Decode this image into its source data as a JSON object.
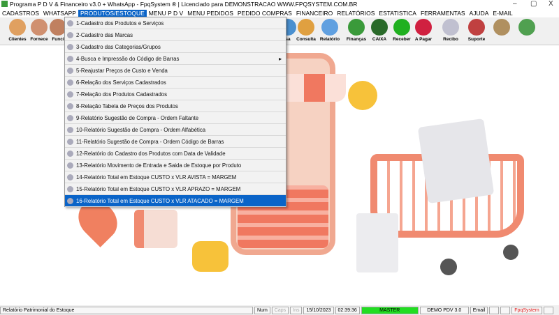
{
  "window": {
    "title": "Programa P D V & Financeiro v3.0 + WhatsApp - FpqSystem ® | Licenciado para  DEMONSTRACAO WWW.FPQSYSTEM.COM.BR",
    "minimize": "–",
    "maximize": "▢",
    "close": "X"
  },
  "menubar": [
    "CADASTROS",
    "WHATSAPP",
    "PRODUTOS/ESTOQUE",
    "MENU P D V",
    "MENU PEDIDOS",
    "PEDIDO COMPRAS",
    "FINANCEIRO",
    "RELATÓRIOS",
    "ESTATISTICA",
    "FERRAMENTAS",
    "AJUDA",
    "E-MAIL"
  ],
  "toolbar": [
    {
      "label": "Clientes",
      "color": "#e0a060"
    },
    {
      "label": "Fornece",
      "color": "#d09070"
    },
    {
      "label": "Funci",
      "color": "#c08060"
    },
    {
      "label": "sa",
      "color": "#4a90d0"
    },
    {
      "label": "Consulta",
      "color": "#e0a040"
    },
    {
      "label": "Relatório",
      "color": "#60a0e0"
    },
    {
      "label": "Finanças",
      "color": "#3a9a3a"
    },
    {
      "label": "CAIXA",
      "color": "#2a6a2a"
    },
    {
      "label": "Receber",
      "color": "#20b020"
    },
    {
      "label": "A Pagar",
      "color": "#d02040"
    },
    {
      "label": "Recibo",
      "color": "#c0c0d0"
    },
    {
      "label": "Suporte",
      "color": "#c04040"
    },
    {
      "label": "",
      "color": "#b09060"
    },
    {
      "label": "",
      "color": "#50a050"
    }
  ],
  "dropdown": [
    {
      "label": "1-Cadastro dos Produtos e Serviços"
    },
    {
      "label": "2-Cadastro das Marcas"
    },
    {
      "label": "3-Cadastro das Categorias/Grupos"
    },
    {
      "label": "4-Busca e Impressão do Código de Barras",
      "submenu": "▸"
    },
    {
      "label": "5-Reajustar Preços de Custo e Venda"
    },
    {
      "label": "6-Relação dos Serviços Cadastrados"
    },
    {
      "label": "7-Relação dos Produtos Cadastrados"
    },
    {
      "label": "8-Relação Tabela de Preços dos Produtos"
    },
    {
      "label": "9-Relatório Sugestão de Compra - Ordem Faltante"
    },
    {
      "label": "10-Relatório Sugestão de Compra - Ordem Alfabética"
    },
    {
      "label": "11-Relatório Sugestão de Compra - Ordem Código de Barras"
    },
    {
      "label": "12-Relatório do Cadastro dos Produtos com Data de Validade"
    },
    {
      "label": "13-Relatório Movimento de Entrada e Saida de Estoque por Produto"
    },
    {
      "label": "14-Relatório Total em Estoque CUSTO x VLR AVISTA = MARGEM"
    },
    {
      "label": "15-Relatório Total em Estoque CUSTO x VLR APRAZO = MARGEM"
    },
    {
      "label": "16-Relatório Total em Estoque CUSTO x VLR ATACADO = MARGEM"
    }
  ],
  "status": {
    "message": "Relatório Patrimonial do Estoque",
    "num": "Num",
    "caps": "Caps",
    "ins": "Ins",
    "date": "15/10/2023",
    "time": "02:39:36",
    "user": "MASTER",
    "version": "DEMO PDV 3.0",
    "email": "Email",
    "brand": "FpqSystem",
    "master_color": "#22dd22"
  }
}
